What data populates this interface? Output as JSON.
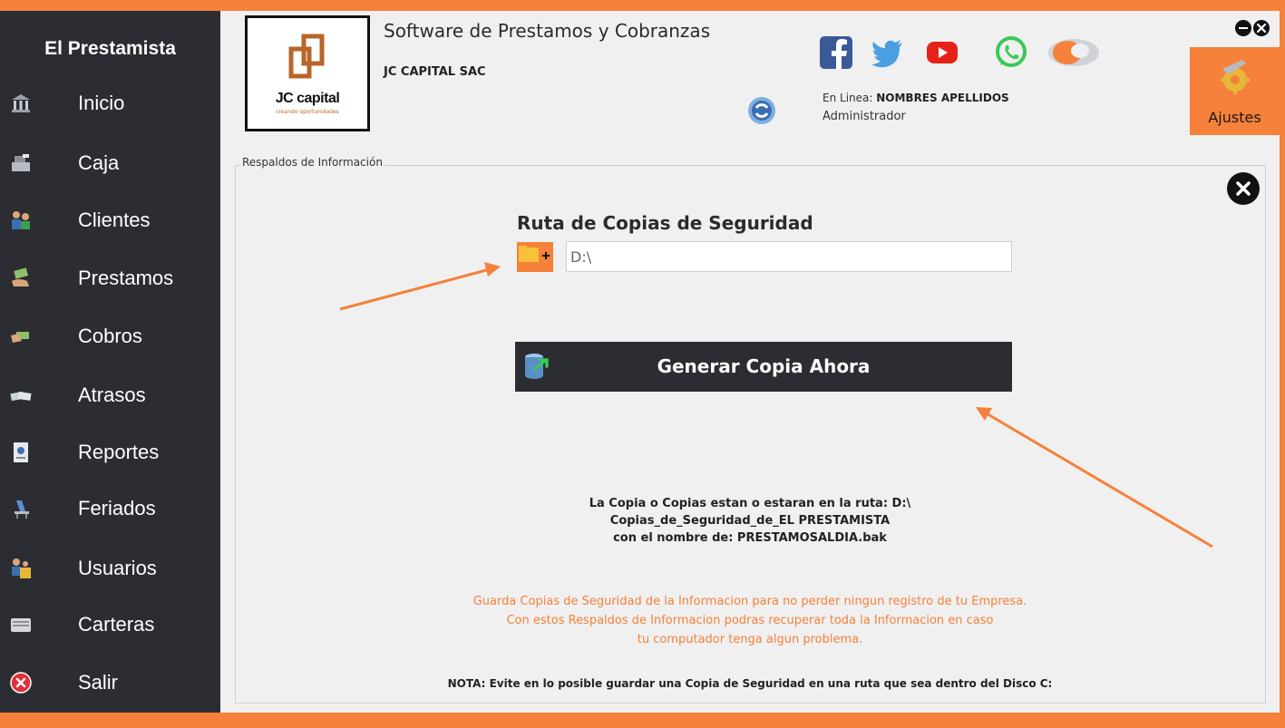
{
  "app": {
    "title": "El Prestamista"
  },
  "sidebar": {
    "items": [
      {
        "label": "Inicio",
        "icon": "bank-icon"
      },
      {
        "label": "Caja",
        "icon": "cash-register-icon"
      },
      {
        "label": "Clientes",
        "icon": "clients-icon"
      },
      {
        "label": "Prestamos",
        "icon": "loan-hand-icon"
      },
      {
        "label": "Cobros",
        "icon": "payment-hand-icon"
      },
      {
        "label": "Atrasos",
        "icon": "money-bills-icon"
      },
      {
        "label": "Reportes",
        "icon": "report-icon"
      },
      {
        "label": "Feriados",
        "icon": "holiday-chair-icon"
      },
      {
        "label": "Usuarios",
        "icon": "users-icon"
      },
      {
        "label": "Carteras",
        "icon": "wallet-icon"
      },
      {
        "label": "Salir",
        "icon": "exit-icon"
      }
    ]
  },
  "header": {
    "logo_text": "JC capital",
    "logo_subtext": "creando oportunidades",
    "software_title": "Software de Prestamos y Cobranzas",
    "company_name": "JC CAPITAL SAC",
    "online_prefix": "En Linea: ",
    "online_user": "NOMBRES APELLIDOS",
    "role": "Administrador",
    "settings_label": "Ajustes",
    "social": [
      "facebook-icon",
      "twitter-icon",
      "youtube-icon",
      "whatsapp-icon",
      "mouse-icon"
    ]
  },
  "backup": {
    "legend": "Respaldos  de Información",
    "route_title": "Ruta de Copias de Seguridad",
    "path_value": "D:\\",
    "generate_label": "Generar Copia Ahora",
    "info_line1": "La Copia o Copias estan o estaran en la ruta: D:\\",
    "info_line2": "Copias_de_Seguridad_de_EL PRESTAMISTA",
    "info_line3": "con el nombre de: PRESTAMOSALDIA.bak",
    "orange_line1": "Guarda Copias de Seguridad de la Informacion para no perder ningun registro de tu Empresa.",
    "orange_line2": "Con estos Respaldos de Informacion podras recuperar toda la Informacion en caso",
    "orange_line3": "tu computador tenga algun problema.",
    "note": "NOTA: Evite en lo posible guardar una Copia de Seguridad en una ruta que sea dentro del Disco C:"
  },
  "colors": {
    "accent": "#f5813a",
    "sidebar": "#2b2d33",
    "panel": "#f0f0f0"
  }
}
